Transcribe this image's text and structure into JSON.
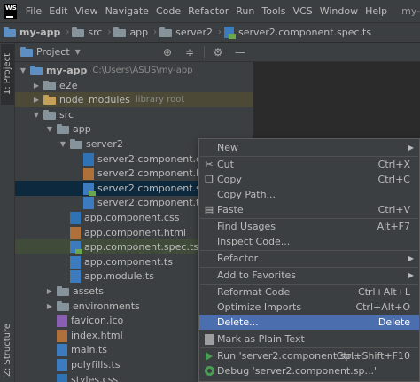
{
  "app": {
    "logo_text": "WS",
    "menu": [
      "File",
      "Edit",
      "View",
      "Navigate",
      "Code",
      "Refactor",
      "Run",
      "Tools",
      "VCS",
      "Window",
      "Help"
    ],
    "project_name": "my-app"
  },
  "breadcrumb": [
    "my-app",
    "src",
    "app",
    "server2",
    "server2.component.spec.ts"
  ],
  "left_tabs": {
    "project": "1: Project",
    "structure": "Z: Structure"
  },
  "panel": {
    "title": "Project"
  },
  "tree": [
    {
      "label": "my-app",
      "hint": "C:\\Users\\ASUS\\my-app",
      "depth": 0,
      "arrow": "down",
      "icon": "folder-blue",
      "bold": true
    },
    {
      "label": "e2e",
      "hint": "",
      "depth": 1,
      "arrow": "right",
      "icon": "folder"
    },
    {
      "label": "node_modules",
      "hint": "library root",
      "depth": 1,
      "arrow": "right",
      "icon": "folder-yellow",
      "state": "excluded"
    },
    {
      "label": "src",
      "hint": "",
      "depth": 1,
      "arrow": "down",
      "icon": "folder"
    },
    {
      "label": "app",
      "hint": "",
      "depth": 2,
      "arrow": "down",
      "icon": "folder"
    },
    {
      "label": "server2",
      "hint": "",
      "depth": 3,
      "arrow": "down",
      "icon": "folder"
    },
    {
      "label": "server2.component.css",
      "hint": "",
      "depth": 4,
      "arrow": "",
      "icon": "css"
    },
    {
      "label": "server2.component.html",
      "hint": "",
      "depth": 4,
      "arrow": "",
      "icon": "html"
    },
    {
      "label": "server2.component.spec.ts",
      "hint": "",
      "depth": 4,
      "arrow": "",
      "icon": "spec",
      "state": "selected"
    },
    {
      "label": "server2.component.ts",
      "hint": "",
      "depth": 4,
      "arrow": "",
      "icon": "ts"
    },
    {
      "label": "app.component.css",
      "hint": "",
      "depth": 3,
      "arrow": "",
      "icon": "css"
    },
    {
      "label": "app.component.html",
      "hint": "",
      "depth": 3,
      "arrow": "",
      "icon": "html"
    },
    {
      "label": "app.component.spec.ts",
      "hint": "",
      "depth": 3,
      "arrow": "",
      "icon": "spec",
      "state": "highlight"
    },
    {
      "label": "app.component.ts",
      "hint": "",
      "depth": 3,
      "arrow": "",
      "icon": "ts"
    },
    {
      "label": "app.module.ts",
      "hint": "",
      "depth": 3,
      "arrow": "",
      "icon": "ts"
    },
    {
      "label": "assets",
      "hint": "",
      "depth": 2,
      "arrow": "right",
      "icon": "folder"
    },
    {
      "label": "environments",
      "hint": "",
      "depth": 2,
      "arrow": "right",
      "icon": "folder"
    },
    {
      "label": "favicon.ico",
      "hint": "",
      "depth": 2,
      "arrow": "",
      "icon": "ico"
    },
    {
      "label": "index.html",
      "hint": "",
      "depth": 2,
      "arrow": "",
      "icon": "html"
    },
    {
      "label": "main.ts",
      "hint": "",
      "depth": 2,
      "arrow": "",
      "icon": "ts"
    },
    {
      "label": "polyfills.ts",
      "hint": "",
      "depth": 2,
      "arrow": "",
      "icon": "ts"
    },
    {
      "label": "styles.css",
      "hint": "",
      "depth": 2,
      "arrow": "",
      "icon": "css"
    }
  ],
  "context_menu": [
    {
      "label": "New",
      "shortcut": "",
      "submenu": true,
      "icon": ""
    },
    {
      "separator": true
    },
    {
      "label": "Cut",
      "shortcut": "Ctrl+X",
      "icon": "cut"
    },
    {
      "label": "Copy",
      "shortcut": "Ctrl+C",
      "icon": "copy"
    },
    {
      "label": "Copy Path...",
      "shortcut": "",
      "icon": ""
    },
    {
      "label": "Paste",
      "shortcut": "Ctrl+V",
      "icon": "paste"
    },
    {
      "separator": true
    },
    {
      "label": "Find Usages",
      "shortcut": "Alt+F7",
      "icon": ""
    },
    {
      "label": "Inspect Code...",
      "shortcut": "",
      "icon": ""
    },
    {
      "separator": true
    },
    {
      "label": "Refactor",
      "shortcut": "",
      "submenu": true,
      "icon": ""
    },
    {
      "separator": true
    },
    {
      "label": "Add to Favorites",
      "shortcut": "",
      "submenu": true,
      "icon": ""
    },
    {
      "separator": true
    },
    {
      "label": "Reformat Code",
      "shortcut": "Ctrl+Alt+L",
      "icon": ""
    },
    {
      "label": "Optimize Imports",
      "shortcut": "Ctrl+Alt+O",
      "icon": ""
    },
    {
      "label": "Delete...",
      "shortcut": "Delete",
      "icon": "",
      "active": true
    },
    {
      "separator": true
    },
    {
      "label": "Mark as Plain Text",
      "shortcut": "",
      "icon": "mark"
    },
    {
      "separator": true
    },
    {
      "label": "Run 'server2.component.sp...'",
      "shortcut": "Ctrl+Shift+F10",
      "icon": "run"
    },
    {
      "label": "Debug 'server2.component.sp...'",
      "shortcut": "",
      "icon": "debug"
    }
  ]
}
